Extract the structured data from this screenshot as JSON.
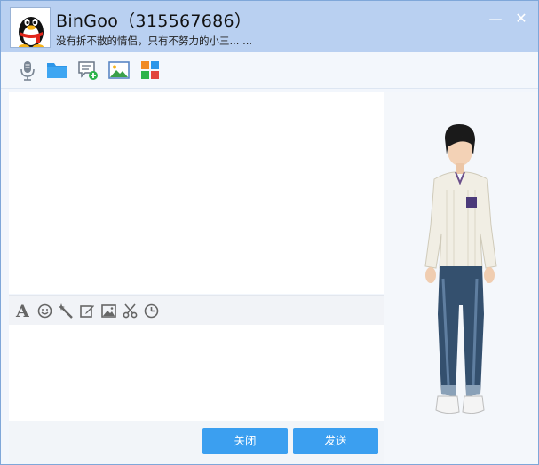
{
  "window": {
    "contact_name": "BinGoo（315567686）",
    "signature": "没有拆不散的情侣，只有不努力的小三... ...",
    "minimize_glyph": "—",
    "close_glyph": "✕"
  },
  "toolbar": {
    "items": [
      {
        "name": "voice-call",
        "icon": "microphone-icon"
      },
      {
        "name": "send-file",
        "icon": "folder-icon"
      },
      {
        "name": "create-discussion",
        "icon": "chat-add-icon"
      },
      {
        "name": "send-image",
        "icon": "picture-icon"
      },
      {
        "name": "apps",
        "icon": "apps-grid-icon"
      }
    ]
  },
  "format_bar": {
    "items": [
      {
        "name": "font",
        "icon": "font-icon",
        "glyph": "A"
      },
      {
        "name": "emoji",
        "icon": "smiley-icon"
      },
      {
        "name": "magic",
        "icon": "magic-wand-icon"
      },
      {
        "name": "doodle",
        "icon": "edit-icon"
      },
      {
        "name": "image",
        "icon": "image-icon"
      },
      {
        "name": "screenshot",
        "icon": "scissors-icon"
      },
      {
        "name": "history",
        "icon": "clock-icon"
      }
    ]
  },
  "buttons": {
    "close_label": "关闭",
    "send_label": "发送"
  },
  "colors": {
    "titlebar": "#b9d0f1",
    "button": "#3b9ff0",
    "icon_gray": "#666666"
  }
}
